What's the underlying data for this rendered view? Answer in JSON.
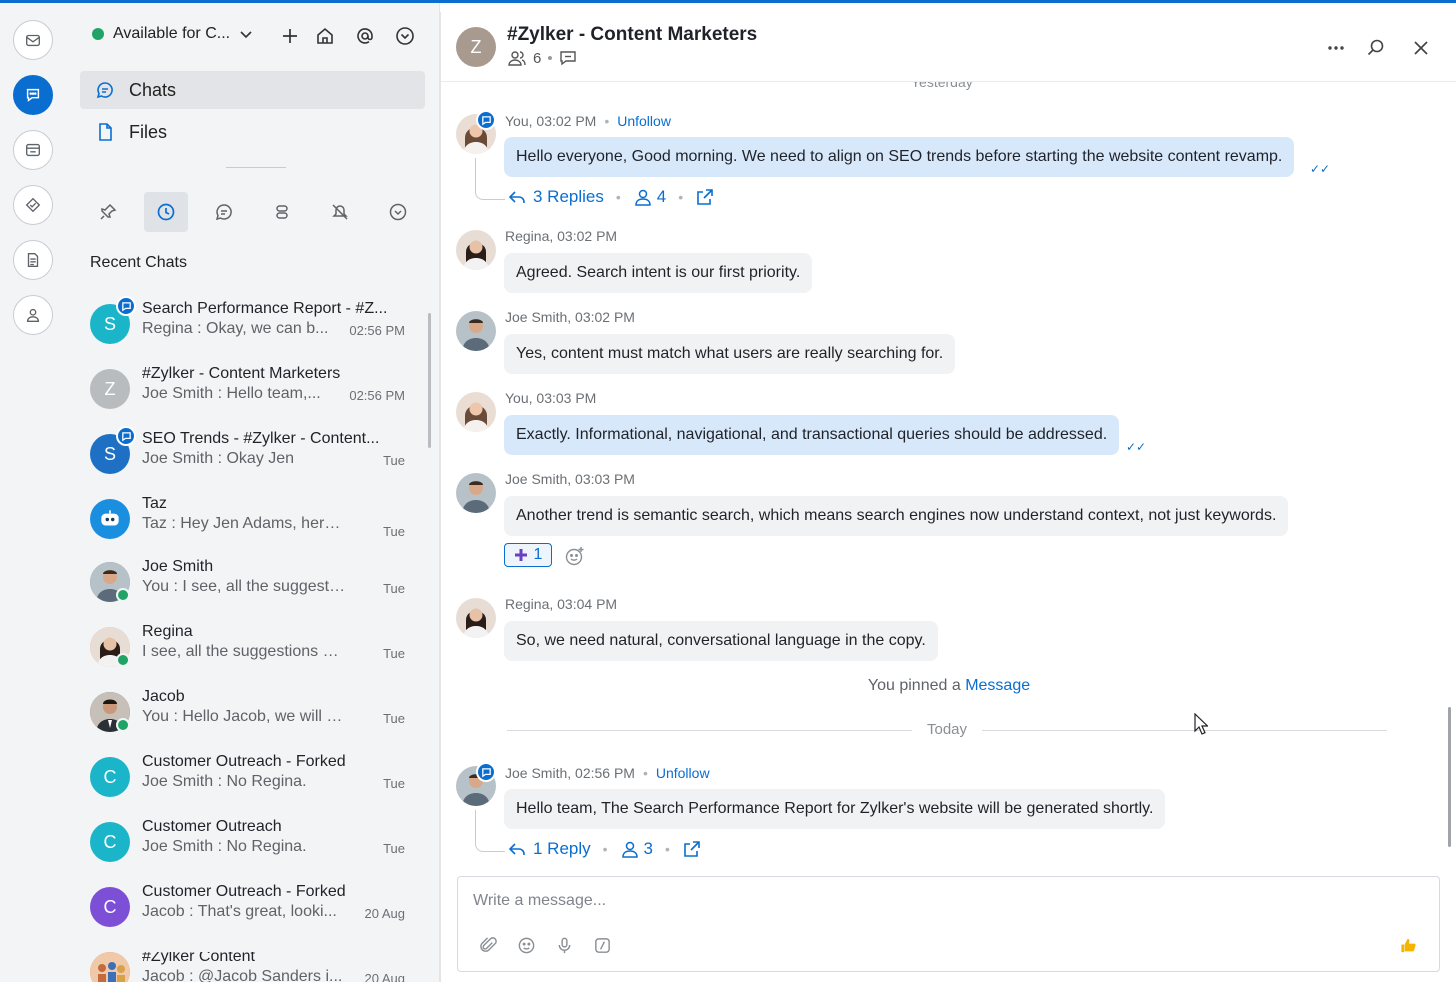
{
  "status": {
    "label": "Available for C...",
    "color": "#21a366"
  },
  "nav": {
    "chats": "Chats",
    "files": "Files"
  },
  "section_title": "Recent Chats",
  "chats": [
    {
      "initial": "S",
      "name": "Search Performance Report - #Z...",
      "msg": "Regina : Okay, we can b...",
      "time": "02:56 PM",
      "color": "#1ab5c9"
    },
    {
      "initial": "Z",
      "name": "#Zylker - Content Marketers",
      "msg": "Joe Smith : Hello team,...",
      "time": "02:56 PM",
      "color": "#b9bcbf"
    },
    {
      "initial": "S",
      "name": "SEO Trends - #Zylker - Content...",
      "msg": "Joe Smith : Okay Jen",
      "time": "Tue",
      "color": "#1d70c4"
    },
    {
      "initial": "",
      "name": "Taz",
      "msg": "Taz : Hey Jen Adams, here's y...",
      "time": "Tue",
      "color": "#1a8fe0"
    },
    {
      "initial": "",
      "name": "Joe Smith",
      "msg": "You : I see, all the suggestion...",
      "time": "Tue",
      "color": "#7a8a93"
    },
    {
      "initial": "",
      "name": "Regina",
      "msg": "I see, all the suggestions will i...",
      "time": "Tue",
      "color": "#c9a48f"
    },
    {
      "initial": "",
      "name": "Jacob",
      "msg": "You : Hello Jacob, we will hav...",
      "time": "Tue",
      "color": "#6e5b50"
    },
    {
      "initial": "C",
      "name": "Customer Outreach - Forked",
      "msg": "Joe Smith : No Regina.",
      "time": "Tue",
      "color": "#1ab5c9"
    },
    {
      "initial": "C",
      "name": "Customer Outreach",
      "msg": "Joe Smith : No Regina.",
      "time": "Tue",
      "color": "#1ab5c9"
    },
    {
      "initial": "C",
      "name": "Customer Outreach - Forked",
      "msg": "Jacob : That's great, looki...",
      "time": "20 Aug",
      "color": "#7c4fd6"
    },
    {
      "initial": "",
      "name": "#Zylker Content",
      "msg": "Jacob : @Jacob Sanders i...",
      "time": "20 Aug",
      "color": "#d9845c"
    }
  ],
  "header": {
    "initial": "Z",
    "title": "#Zylker - Content Marketers",
    "members": "6"
  },
  "feed": {
    "yesterday": "Yesterday",
    "messages": [
      {
        "sender": "You, 03:02 PM",
        "follow": "Unfollow",
        "text": "Hello everyone, Good morning. We need to align on SEO trends before starting the website content revamp.",
        "replies": "3 Replies",
        "participants": "4"
      },
      {
        "sender": "Regina, 03:02 PM",
        "text": "Agreed. Search intent is our first priority."
      },
      {
        "sender": "Joe Smith, 03:02 PM",
        "text": "Yes, content must match what users are really searching for."
      },
      {
        "sender": "You, 03:03 PM",
        "text": "Exactly. Informational, navigational, and transactional queries should be addressed."
      },
      {
        "sender": "Joe Smith, 03:03 PM",
        "text": "Another trend is semantic search, which means search engines now understand context, not just keywords.",
        "reaction": "1"
      },
      {
        "sender": "Regina, 03:04 PM",
        "text": "So, we need natural, conversational language in the copy."
      },
      {
        "sender": "Joe Smith, 02:56 PM",
        "follow": "Unfollow",
        "text": "Hello team, The Search Performance Report for Zylker's website will be generated shortly.",
        "replies": "1 Reply",
        "participants": "3"
      }
    ],
    "pinned_prefix": "You pinned a",
    "pinned_link": "Message",
    "today": "Today"
  },
  "composer": {
    "placeholder": "Write a message..."
  },
  "accent": "#0a6ed1"
}
